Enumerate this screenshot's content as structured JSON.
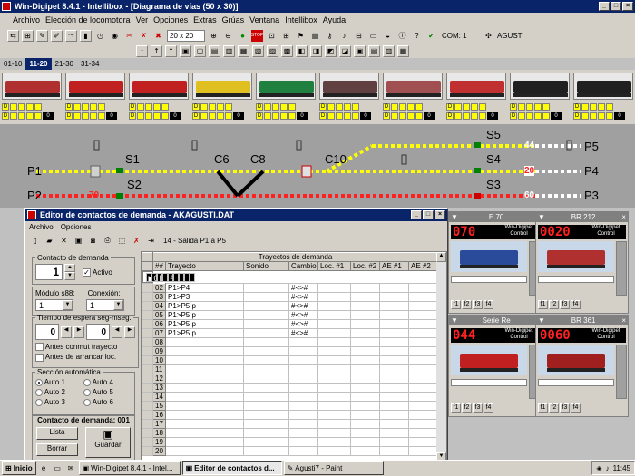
{
  "window": {
    "title": "Win-Digipet 8.4.1 - Intellibox - [Diagrama de vías (50 x 30)]"
  },
  "menu": [
    "Archivo",
    "Elección de locomotora",
    "Ver",
    "Opciones",
    "Extras",
    "Grúas",
    "Ventana",
    "Intellibox",
    "Ayuda"
  ],
  "toolbar": {
    "zoom": "20 x 20",
    "com": "COM: 1",
    "user": "AGUSTI"
  },
  "page_tabs": [
    "01-10",
    "11-20",
    "21-30",
    "31-34"
  ],
  "active_page_tab": "11-20",
  "locos": [
    {
      "color": "#b03030"
    },
    {
      "color": "#c02020"
    },
    {
      "color": "#c02020"
    },
    {
      "color": "#e0c020"
    },
    {
      "color": "#208040"
    },
    {
      "color": "#604040"
    },
    {
      "color": "#a05050"
    },
    {
      "color": "#c03030"
    },
    {
      "color": "#202020"
    },
    {
      "color": "#202020"
    }
  ],
  "loco_counters": [
    "0",
    "0",
    "0",
    "0",
    "0",
    "0",
    "0",
    "0",
    "0",
    "0"
  ],
  "track": {
    "labels": {
      "p1": "P1",
      "p2": "P2",
      "p3": "P3",
      "p4": "P4",
      "p5": "P5",
      "s1": "S1",
      "s2": "S2",
      "s3": "S3",
      "s4": "S4",
      "s5": "S5",
      "c6": "C6",
      "c8": "C8",
      "c10": "C10"
    },
    "speeds": {
      "p2_speed": "70",
      "s4_speed": "20",
      "s5_speed": "44",
      "s3_speed": "60"
    }
  },
  "dialog": {
    "title": "Editor de contactos de demanda - AKAGUSTI.DAT",
    "menu": [
      "Archivo",
      "Opciones"
    ],
    "route_name": "14 - Salida P1 a P5",
    "contact_group": "Contacto de demanda",
    "contact_number": "1",
    "active_label": "Activo",
    "module_label": "Módulo s88:",
    "module_value": "1",
    "connection_label": "Conexión:",
    "connection_value": "1",
    "wait_group": "Tiempo de espera seg-mseg.",
    "wait_sec": "0",
    "wait_msec": "0",
    "before_switch": "Antes conmut trayecto",
    "before_start": "Antes de arrancar loc.",
    "auto_group": "Sección automática",
    "autos": [
      "Auto 1",
      "Auto 4",
      "Auto 2",
      "Auto 5",
      "Auto 3",
      "Auto 6"
    ],
    "footer_label": "Contacto de demanda: 001",
    "list_button": "Lista",
    "delete_button": "Borrar",
    "save_button": "Guardar",
    "grid_header": "Trayectos de demanda",
    "columns": [
      "##",
      "Trayecto",
      "Sonido",
      "Cambio",
      "Loc. #1",
      "Loc. #2",
      "AE #1",
      "AE #2"
    ],
    "rows": [
      [
        "01",
        "P1>P5",
        "",
        "#<>#",
        "",
        "",
        "",
        ""
      ],
      [
        "02",
        "P1>P4",
        "",
        "#<>#",
        "",
        "",
        "",
        ""
      ],
      [
        "03",
        "P1>P3",
        "",
        "#<>#",
        "",
        "",
        "",
        ""
      ],
      [
        "04",
        "P1>P5 p",
        "",
        "#<>#",
        "",
        "",
        "",
        ""
      ],
      [
        "05",
        "P1>P5 p",
        "",
        "#<>#",
        "",
        "",
        "",
        ""
      ],
      [
        "06",
        "P1>P5 p",
        "",
        "#<>#",
        "",
        "",
        "",
        ""
      ],
      [
        "07",
        "P1>P5 p",
        "",
        "#<>#",
        "",
        "",
        "",
        ""
      ],
      [
        "08",
        "",
        "",
        "",
        "",
        "",
        "",
        ""
      ],
      [
        "09",
        "",
        "",
        "",
        "",
        "",
        "",
        ""
      ],
      [
        "10",
        "",
        "",
        "",
        "",
        "",
        "",
        ""
      ],
      [
        "11",
        "",
        "",
        "",
        "",
        "",
        "",
        ""
      ],
      [
        "12",
        "",
        "",
        "",
        "",
        "",
        "",
        ""
      ],
      [
        "13",
        "",
        "",
        "",
        "",
        "",
        "",
        ""
      ],
      [
        "14",
        "",
        "",
        "",
        "",
        "",
        "",
        ""
      ],
      [
        "15",
        "",
        "",
        "",
        "",
        "",
        "",
        ""
      ],
      [
        "16",
        "",
        "",
        "",
        "",
        "",
        "",
        ""
      ],
      [
        "17",
        "",
        "",
        "",
        "",
        "",
        "",
        ""
      ],
      [
        "18",
        "",
        "",
        "",
        "",
        "",
        "",
        ""
      ],
      [
        "19",
        "",
        "",
        "",
        "",
        "",
        "",
        ""
      ],
      [
        "20",
        "",
        "",
        "",
        "",
        "",
        "",
        ""
      ]
    ]
  },
  "regulators": [
    {
      "name": "E 70",
      "speed": "070",
      "label": "Win-Digipet Control"
    },
    {
      "name": "BR 212",
      "speed": "0020",
      "label": "Win-Digipet Control"
    },
    {
      "name": "Serie Re",
      "speed": "044",
      "label": "Win-Digipet Control"
    },
    {
      "name": "BR 361",
      "speed": "0060",
      "label": "Win-Digipet Control"
    }
  ],
  "taskbar": {
    "start": "Inicio",
    "tasks": [
      "Win-Digipet 8.4.1 - Intel...",
      "Editor de contactos d...",
      "Agusti7 - Paint"
    ],
    "clock": "11:45"
  }
}
